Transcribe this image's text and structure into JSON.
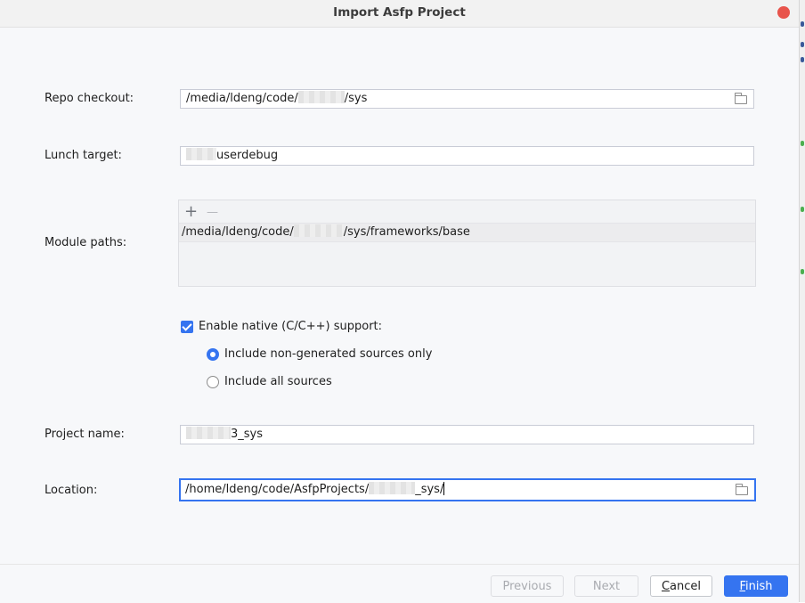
{
  "dialog": {
    "title": "Import Asfp Project"
  },
  "form": {
    "repo_checkout": {
      "label": "Repo checkout:",
      "value_prefix": "/media/ldeng/code/",
      "value_suffix": "/sys"
    },
    "lunch_target": {
      "label": "Lunch target:",
      "value_suffix": "userdebug"
    },
    "module_paths": {
      "label": "Module paths:",
      "add_glyph": "+",
      "remove_glyph": "—",
      "items": [
        {
          "prefix": "/media/ldeng/code/",
          "suffix": "/sys/frameworks/base"
        }
      ]
    },
    "native_support": {
      "label": "Enable native (C/C++) support:",
      "checked": true,
      "options": [
        {
          "label": "Include non-generated sources only",
          "selected": true
        },
        {
          "label": "Include all sources",
          "selected": false
        }
      ]
    },
    "project_name": {
      "label": "Project name:",
      "value_suffix": "3_sys"
    },
    "location": {
      "label": "Location:",
      "value_prefix": "/home/ldeng/code/AsfpProjects/",
      "value_suffix": "_sys/"
    }
  },
  "footer": {
    "previous_label": "Previous",
    "next_label": "Next",
    "cancel_label": "Cancel",
    "finish_label": "Finish"
  },
  "icons": {
    "folder": "folder-icon",
    "close": "close-icon"
  },
  "colors": {
    "accent": "#3574f0",
    "close": "#e8544c"
  }
}
